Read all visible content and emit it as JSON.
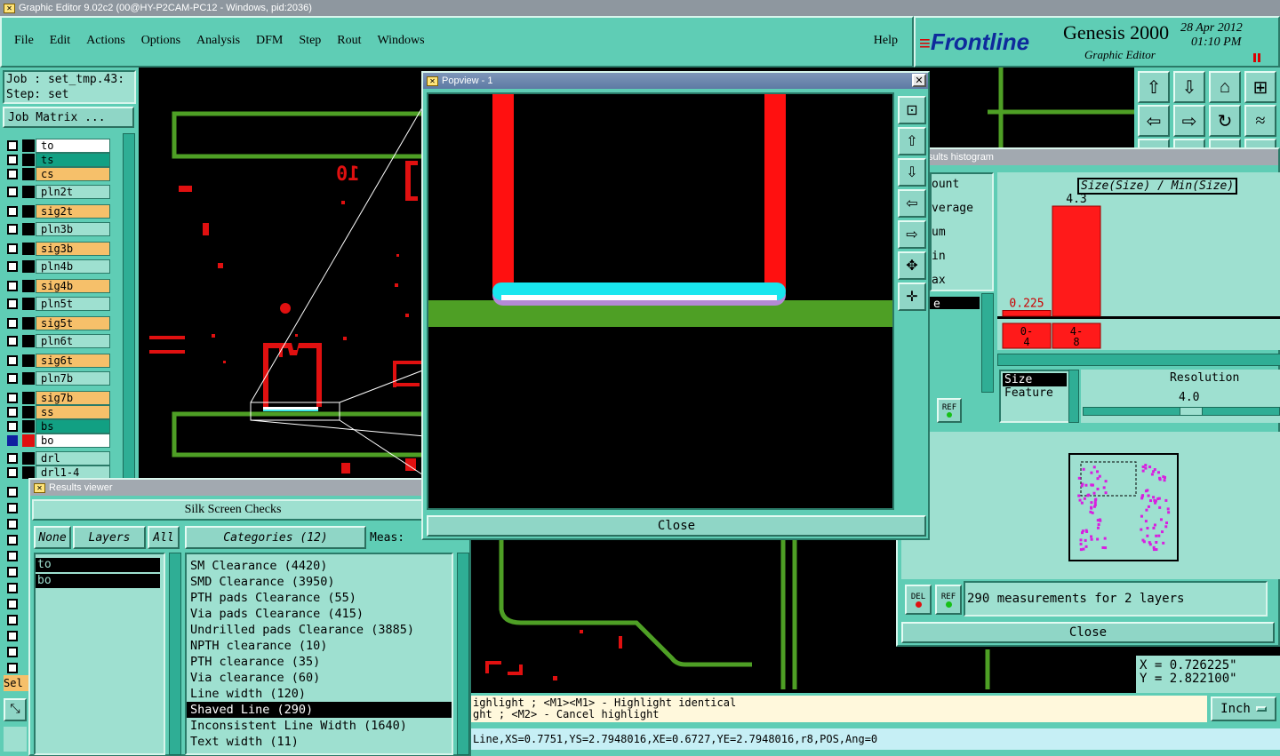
{
  "window_title": "Graphic Editor 9.02c2 (00@HY-P2CAM-PC12 - Windows, pid:2036)",
  "menu": [
    "File",
    "Edit",
    "Actions",
    "Options",
    "Analysis",
    "DFM",
    "Step",
    "Rout",
    "Windows"
  ],
  "help_label": "Help",
  "brand": {
    "logo": "Frontline",
    "product": "Genesis 2000",
    "subtitle": "Graphic Editor",
    "date": "28 Apr 2012",
    "time": "01:10 PM"
  },
  "job": {
    "job_line": "Job : set_tmp.43:",
    "step_line": "Step: set",
    "matrix_button": "Job Matrix ..."
  },
  "layers": [
    {
      "name": "to",
      "color": "#ffffff"
    },
    {
      "name": "ts",
      "color": "#12a083"
    },
    {
      "name": "cs",
      "color": "#f6c06a"
    },
    {
      "name": "pln2t",
      "color": "#9ee0d0"
    },
    {
      "name": "sig2t",
      "color": "#f6c06a"
    },
    {
      "name": "pln3b",
      "color": "#9ee0d0"
    },
    {
      "name": "sig3b",
      "color": "#f6c06a"
    },
    {
      "name": "pln4b",
      "color": "#9ee0d0"
    },
    {
      "name": "sig4b",
      "color": "#f6c06a"
    },
    {
      "name": "pln5t",
      "color": "#9ee0d0"
    },
    {
      "name": "sig5t",
      "color": "#f6c06a"
    },
    {
      "name": "pln6t",
      "color": "#9ee0d0"
    },
    {
      "name": "sig6t",
      "color": "#f6c06a"
    },
    {
      "name": "pln7b",
      "color": "#9ee0d0"
    },
    {
      "name": "sig7b",
      "color": "#f6c06a"
    },
    {
      "name": "ss",
      "color": "#f6c06a"
    },
    {
      "name": "bs",
      "color": "#12a083"
    },
    {
      "name": "bo",
      "color": "#ffffff"
    },
    {
      "name": "drl",
      "color": "#9ee0d0"
    },
    {
      "name": "drl1-4",
      "color": "#9ee0d0"
    }
  ],
  "popview": {
    "title": "Popview - 1",
    "close_label": "Close"
  },
  "histogram": {
    "title": "sults histogram",
    "stats": [
      "ount",
      "verage",
      "um",
      "in",
      "ax"
    ],
    "selected_stat": "e",
    "mode_label": "Size(Size) / Min(Size)",
    "chart_data": {
      "type": "bar",
      "categories": [
        "0-4",
        "4-8"
      ],
      "values": [
        0.225,
        4.3
      ]
    },
    "size_label": "Size",
    "feature_label": "Feature",
    "resolution_label": "Resolution",
    "resolution_value": "4.0",
    "ref_label": "REF",
    "del_label": "DEL",
    "measurements": "290 measurements for 2 layers",
    "close_label": "Close"
  },
  "results": {
    "title": "Results viewer",
    "header": "Silk Screen Checks",
    "none_label": "None",
    "layers_label": "Layers",
    "all_label": "All",
    "categories_label": "Categories (12)",
    "meas_label": "Meas:",
    "layer_list": [
      "to",
      "bo"
    ],
    "categories": [
      "SM Clearance (4420)",
      "SMD Clearance (3950)",
      "PTH pads Clearance (55)",
      "Via pads Clearance (415)",
      "Undrilled pads Clearance (3885)",
      "NPTH clearance (10)",
      "PTH clearance (35)",
      "Via clearance (60)",
      "Line width (120)",
      "Shaved Line (290)",
      "Inconsistent Line Width (1640)",
      "Text width (11)"
    ],
    "selected_category": "Shaved Line (290)"
  },
  "status": {
    "hint1": "ighlight ; <M1><M1> - Highlight identical",
    "hint2": "ght ; <M2> - Cancel highlight",
    "feature_line": "Line,XS=0.7751,YS=2.7948016,XE=0.6727,YE=2.7948016,r8,POS,Ang=0",
    "x": "X = 0.726225\"",
    "y": "Y = 2.822100\"",
    "units": "Inch",
    "sel_label": "Sel"
  },
  "board_text": "10"
}
